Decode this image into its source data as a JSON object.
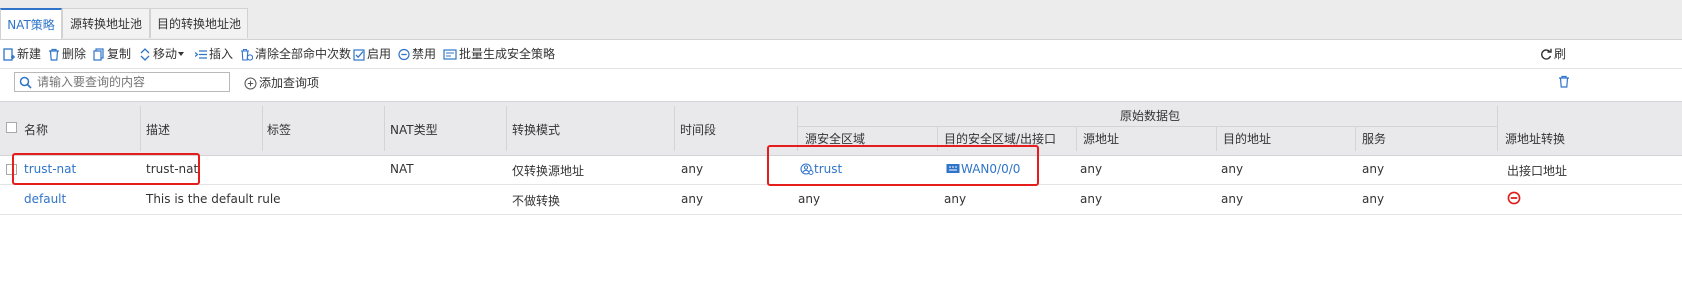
{
  "tabs": [
    {
      "label": "NAT策略"
    },
    {
      "label": "源转换地址池"
    },
    {
      "label": "目的转换地址池"
    }
  ],
  "toolbar": {
    "new": "新建",
    "delete": "删除",
    "copy": "复制",
    "move": "移动",
    "insert": "插入",
    "clear_hits": "清除全部命中次数",
    "enable": "启用",
    "disable": "禁用",
    "batch_generate": "批量生成安全策略",
    "refresh": "刷"
  },
  "search": {
    "placeholder": "请输入要查询的内容",
    "add_query": "添加查询项"
  },
  "table": {
    "headers": {
      "name": "名称",
      "description": "描述",
      "tag": "标签",
      "nat_type": "NAT类型",
      "mode": "转换模式",
      "time": "时间段",
      "original_packet": "原始数据包",
      "src_zone": "源安全区域",
      "dst_zone": "目的安全区域/出接口",
      "src_addr": "源地址",
      "dst_addr": "目的地址",
      "service": "服务",
      "src_translate": "源地址转换"
    },
    "rows": [
      {
        "name": "trust-nat",
        "description": "trust-nat",
        "tag": "",
        "nat_type": "NAT",
        "mode": "仅转换源地址",
        "time": "any",
        "src_zone": "trust",
        "dst_zone": "WAN0/0/0",
        "src_addr": "any",
        "dst_addr": "any",
        "service": "any",
        "src_translate": "出接口地址"
      },
      {
        "name": "default",
        "description": "This is the default rule",
        "tag": "",
        "nat_type": "",
        "mode": "不做转换",
        "time": "any",
        "src_zone": "any",
        "dst_zone": "any",
        "src_addr": "any",
        "dst_addr": "any",
        "service": "any",
        "src_translate_icon": "deny-icon"
      }
    ]
  },
  "colors": {
    "accent": "#2f74c9",
    "highlight": "#e51d1d",
    "deny": "#e01b1b"
  }
}
